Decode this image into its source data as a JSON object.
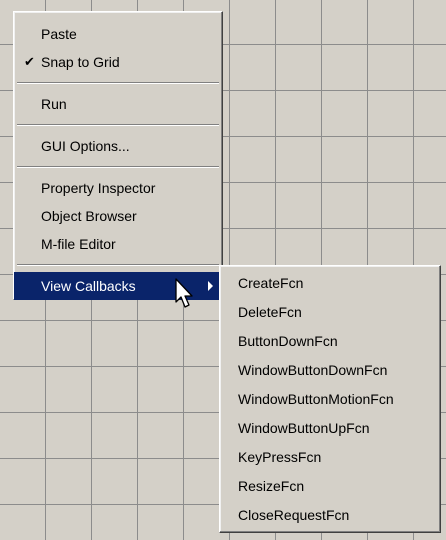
{
  "context_menu": {
    "group1": [
      {
        "label": "Paste",
        "checked": false
      },
      {
        "label": "Snap to Grid",
        "checked": true,
        "check_glyph": "✔"
      }
    ],
    "group2": [
      {
        "label": "Run"
      }
    ],
    "group3": [
      {
        "label": "GUI Options..."
      }
    ],
    "group4": [
      {
        "label": "Property Inspector"
      },
      {
        "label": "Object Browser"
      },
      {
        "label": "M-file Editor"
      }
    ],
    "group5": [
      {
        "label": "View Callbacks",
        "highlighted": true,
        "has_submenu": true
      }
    ]
  },
  "submenu": {
    "items": [
      {
        "label": "CreateFcn"
      },
      {
        "label": "DeleteFcn"
      },
      {
        "label": "ButtonDownFcn"
      },
      {
        "label": "WindowButtonDownFcn"
      },
      {
        "label": "WindowButtonMotionFcn"
      },
      {
        "label": "WindowButtonUpFcn"
      },
      {
        "label": "KeyPressFcn"
      },
      {
        "label": "ResizeFcn"
      },
      {
        "label": "CloseRequestFcn"
      }
    ]
  },
  "colors": {
    "menu_bg": "#d4d0c8",
    "highlight": "#0a246a",
    "grid_line": "#8c8c8c"
  },
  "icons": {
    "cursor": "arrow-pointer-icon",
    "submenu_arrow": "chevron-right-icon"
  }
}
